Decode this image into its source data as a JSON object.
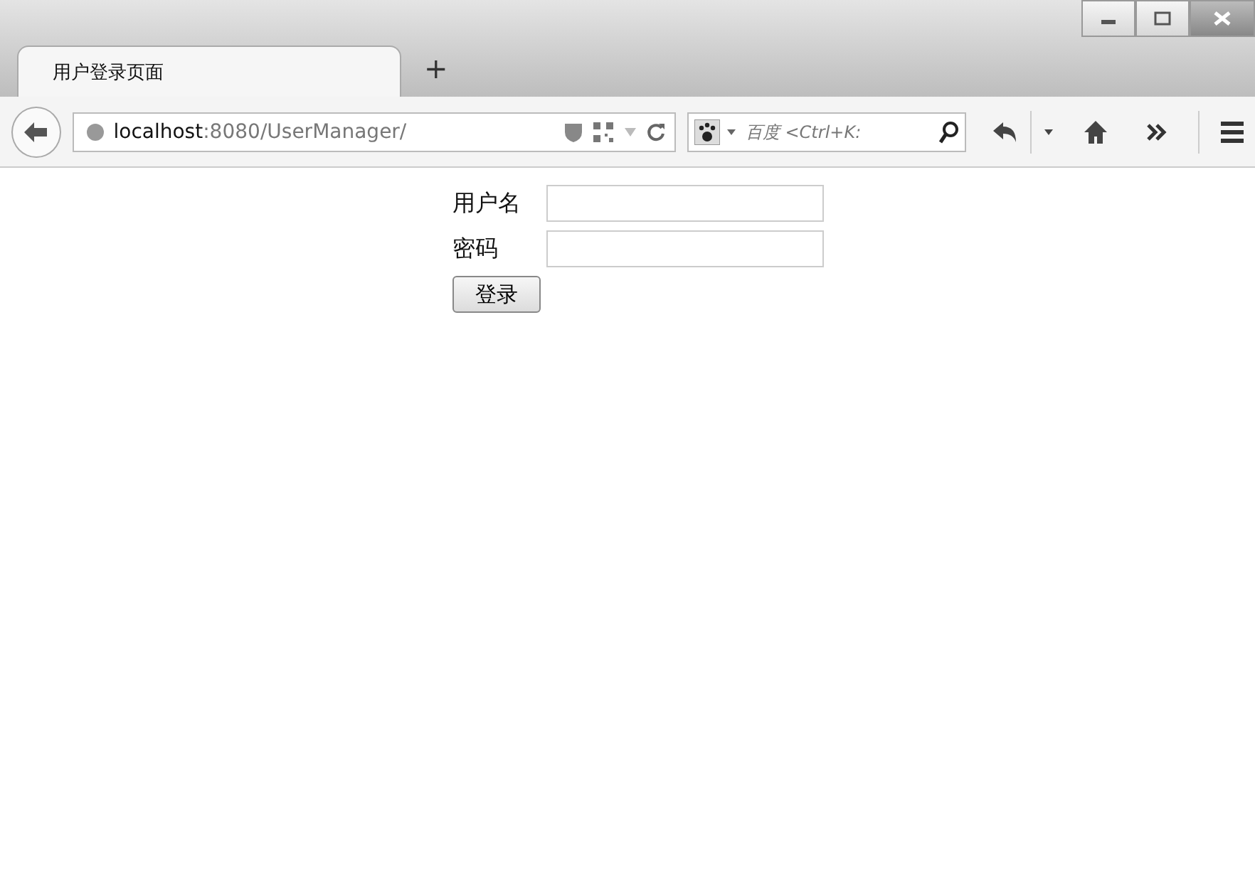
{
  "tabs": [
    {
      "label": "用户登录页面",
      "selected": true
    }
  ],
  "new_tab": "+",
  "address_bar": {
    "host": "localhost",
    "path": ":8080/UserManager/"
  },
  "search": {
    "placeholder": "百度 <Ctrl+K:"
  },
  "form": {
    "fields": [
      {
        "label": "用户名"
      },
      {
        "label": "密码"
      }
    ],
    "submit": "登录"
  }
}
